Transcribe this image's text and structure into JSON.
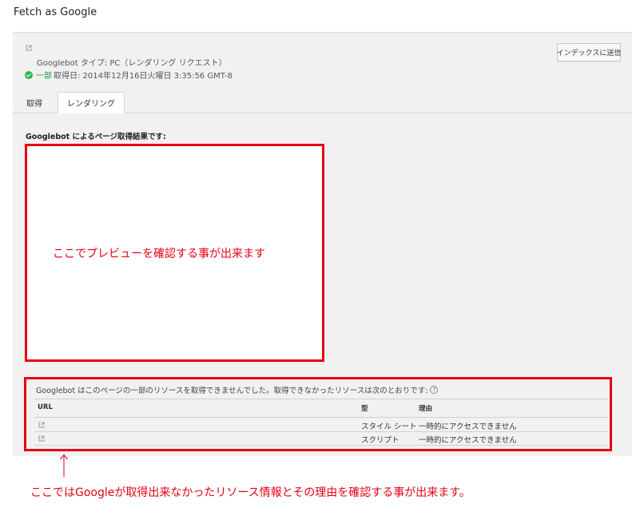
{
  "page": {
    "title": "Fetch as Google"
  },
  "header": {
    "googlebot_type": "Googlebot タイプ: PC（レンダリング リクエスト）",
    "status_partial": "一部",
    "fetch_date": "取得日: 2014年12月16日火曜日 3:35:56 GMT-8",
    "index_button": "インデックスに送信"
  },
  "tabs": [
    {
      "label": "取得"
    },
    {
      "label": "レンダリング"
    }
  ],
  "render": {
    "result_label": "Googlebot によるページ取得結果です:",
    "preview_annotation": "ここでプレビューを確認する事が出来ます"
  },
  "resources": {
    "message": "Googlebot はこのページの一部のリソースを取得できませんでした。取得できなかったリソースは次のとおりです:",
    "help": "?",
    "columns": {
      "url": "URL",
      "type": "型",
      "reason": "理由"
    },
    "rows": [
      {
        "type": "スタイル シート",
        "reason": "一時的にアクセスできません"
      },
      {
        "type": "スクリプト",
        "reason": "一時的にアクセスできません"
      }
    ]
  },
  "annotation": {
    "arrow": "↑",
    "bottom_note": "ここではGoogleが取得出来なかったリソース情報とその理由を確認する事が出来ます。"
  },
  "colors": {
    "annotation_red": "#e60012",
    "status_green": "#2db34a",
    "panel_bg": "#f1f1f1"
  },
  "icons": [
    "external-link-icon",
    "check-circle-icon",
    "help-icon",
    "arrow-up-icon"
  ]
}
